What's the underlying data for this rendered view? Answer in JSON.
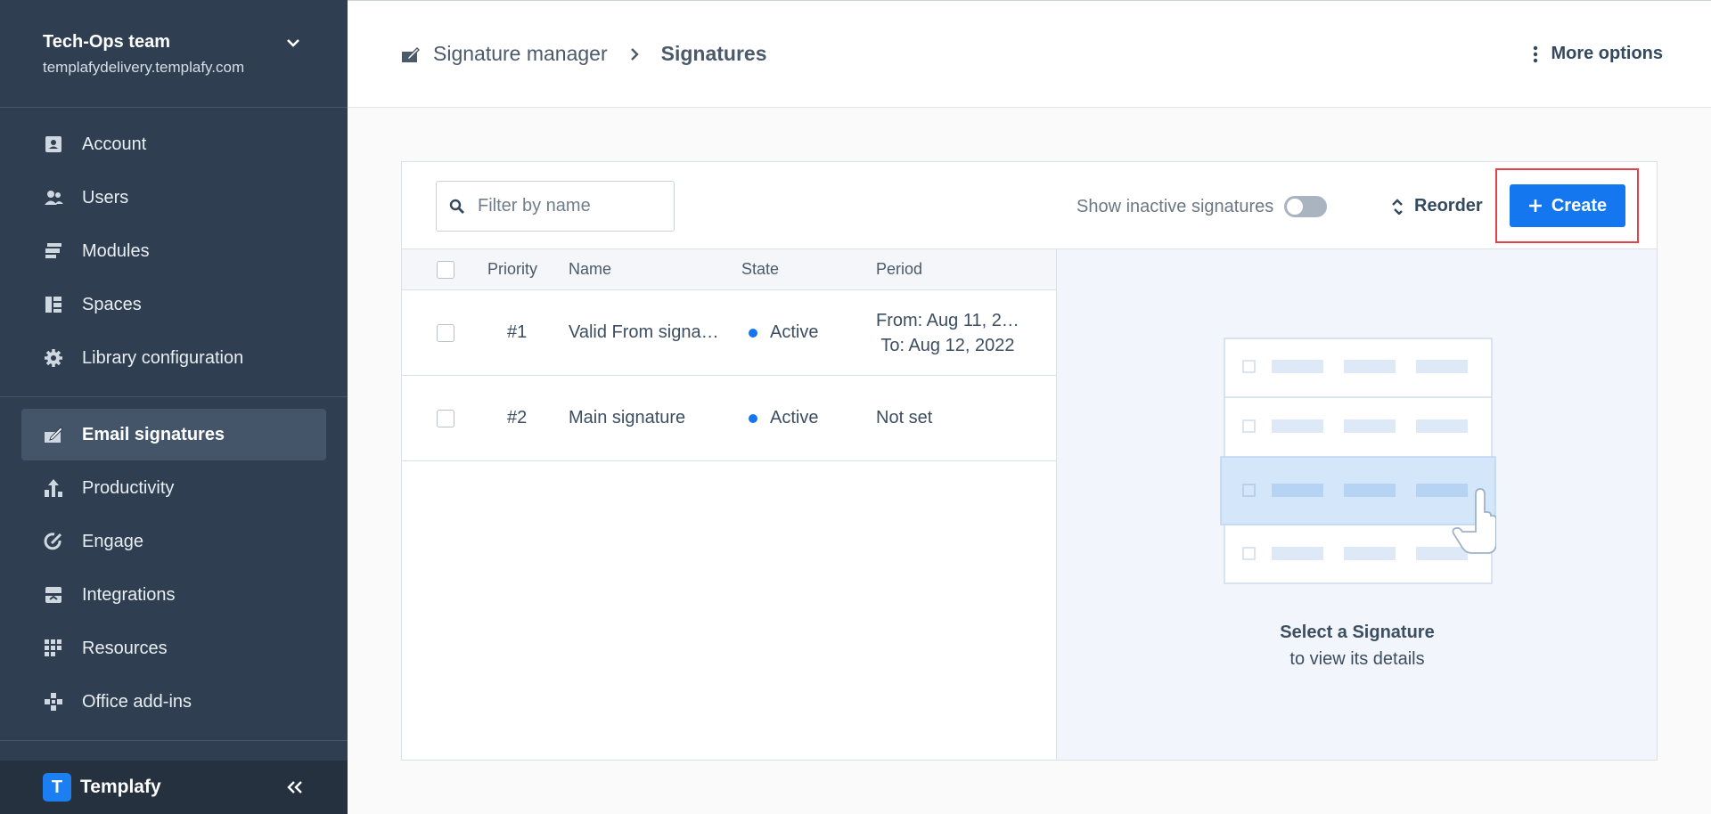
{
  "sidebar": {
    "team_name": "Tech-Ops team",
    "team_url": "templafydelivery.templafy.com",
    "items_top": [
      {
        "label": "Account",
        "icon": "account-icon"
      },
      {
        "label": "Users",
        "icon": "users-icon"
      },
      {
        "label": "Modules",
        "icon": "modules-icon"
      },
      {
        "label": "Spaces",
        "icon": "spaces-icon"
      },
      {
        "label": "Library configuration",
        "icon": "gear-icon"
      }
    ],
    "items_bottom": [
      {
        "label": "Email signatures",
        "icon": "email-signature-icon",
        "active": true
      },
      {
        "label": "Productivity",
        "icon": "productivity-icon"
      },
      {
        "label": "Engage",
        "icon": "engage-icon"
      },
      {
        "label": "Integrations",
        "icon": "integrations-icon"
      },
      {
        "label": "Resources",
        "icon": "resources-icon"
      },
      {
        "label": "Office add-ins",
        "icon": "office-addins-icon"
      }
    ],
    "logo_letter": "T",
    "logo_text": "Templafy"
  },
  "header": {
    "breadcrumb_parent": "Signature manager",
    "breadcrumb_current": "Signatures",
    "more_options": "More options"
  },
  "toolbar": {
    "search_placeholder": "Filter by name",
    "show_inactive_label": "Show inactive signatures",
    "show_inactive_on": false,
    "reorder_label": "Reorder",
    "create_label": "Create"
  },
  "table": {
    "headers": {
      "priority": "Priority",
      "name": "Name",
      "state": "State",
      "period": "Period"
    },
    "rows": [
      {
        "priority": "#1",
        "name": "Valid From signa…",
        "state": "Active",
        "period_from": "From: Aug 11, 2…",
        "period_to": "To: Aug 12, 2022"
      },
      {
        "priority": "#2",
        "name": "Main signature",
        "state": "Active",
        "period": "Not set"
      }
    ]
  },
  "empty_state": {
    "title": "Select a Signature",
    "subtitle": "to view its details"
  },
  "colors": {
    "sidebar_bg": "#2f3e50",
    "accent": "#1477f0",
    "highlight_border": "#e2424a"
  }
}
